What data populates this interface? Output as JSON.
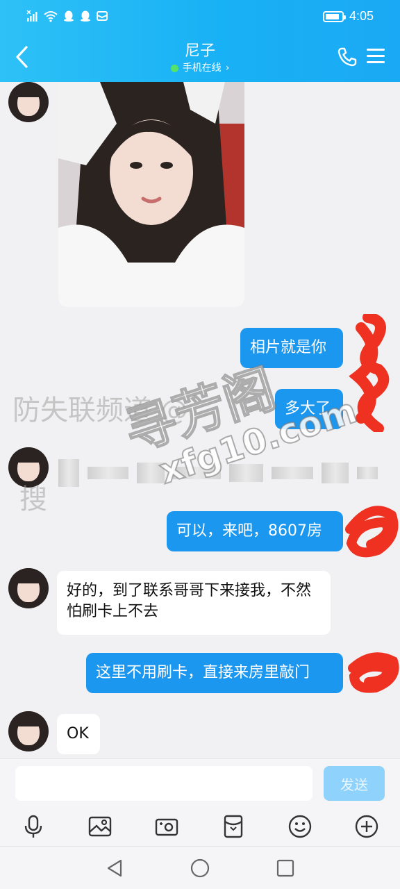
{
  "status": {
    "time": "4:05",
    "left_icons": [
      "signal-icon",
      "wifi-icon",
      "qq-icon",
      "qq-icon",
      "mail-icon"
    ],
    "battery_level": 0.85
  },
  "header": {
    "title": "尼子",
    "presence": "手机在线",
    "presence_chevron": "›",
    "accent": "#19b1f5",
    "online_color": "#55e26b"
  },
  "messages": [
    {
      "side": "in",
      "type": "image",
      "description_icon": "photo"
    },
    {
      "side": "out",
      "text": "相片就是你"
    },
    {
      "side": "out",
      "text": "多大了"
    },
    {
      "side": "in",
      "type": "redacted"
    },
    {
      "side": "out",
      "text": "可以，来吧，8607房"
    },
    {
      "side": "in",
      "text": "好的，到了联系哥哥下来接我，不然怕刷卡上不去"
    },
    {
      "side": "out",
      "text": "这里不用刷卡，直接来房里敲门"
    },
    {
      "side": "in",
      "text": "OK"
    }
  ],
  "watermarks": {
    "channel": "防失联频道 @",
    "brand_cn": "寻芳阁",
    "brand_url": "xfg10.com",
    "fragment_left": "搜"
  },
  "input": {
    "placeholder": "",
    "send_label": "发送"
  },
  "toolbar": [
    "mic-icon",
    "image-icon",
    "camera-icon",
    "red-packet-icon",
    "emoji-icon",
    "plus-icon"
  ],
  "navbar": [
    "back-triangle-icon",
    "home-circle-icon",
    "recents-square-icon"
  ],
  "colors": {
    "bubble_out": "#1b97ef",
    "bubble_in": "#ffffff",
    "background": "#f1f1f3",
    "send_disabled": "#8fd2fb"
  }
}
